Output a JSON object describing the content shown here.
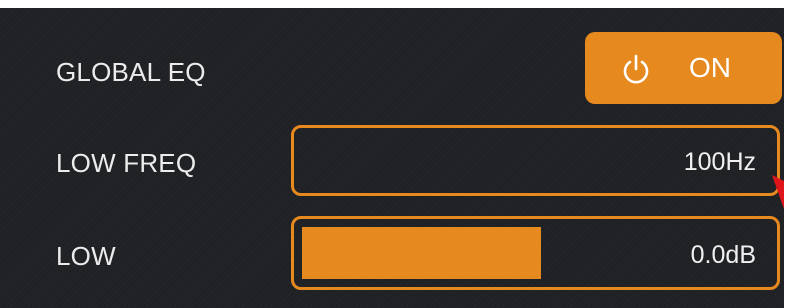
{
  "global_eq": {
    "label": "GLOBAL EQ",
    "toggle_label": "ON",
    "toggle_icon": "power-icon",
    "enabled": true
  },
  "low_freq": {
    "label": "LOW FREQ",
    "value": "100Hz"
  },
  "low": {
    "label": "LOW",
    "value": "0.0dB",
    "level_fraction": 0.5
  },
  "colors": {
    "background": "#202125",
    "accent": "#e6891f",
    "text": "#ececec",
    "marker": "#e0151b"
  }
}
